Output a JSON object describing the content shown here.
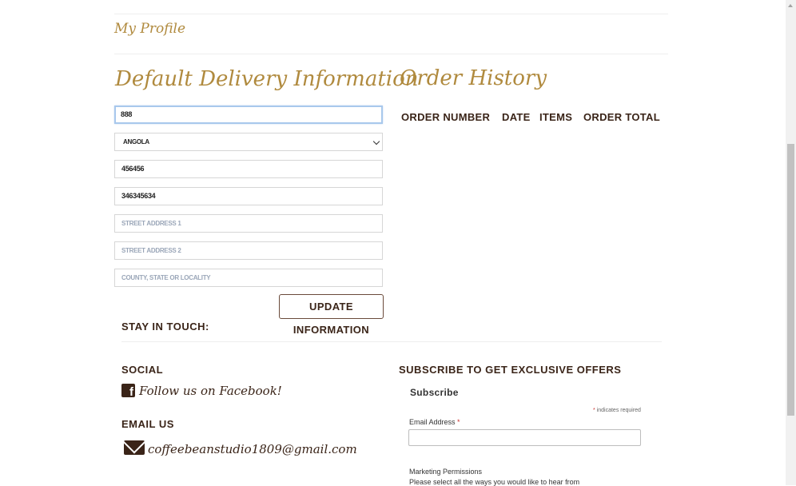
{
  "profile": {
    "title": "My Profile"
  },
  "delivery": {
    "title": "Default Delivery Information",
    "fields": [
      {
        "value": "888",
        "placeholder": ""
      },
      {
        "value": "ANGOLA",
        "placeholder": ""
      },
      {
        "value": "456456",
        "placeholder": ""
      },
      {
        "value": "346345634",
        "placeholder": ""
      },
      {
        "value": "",
        "placeholder": "STREET ADDRESS 1"
      },
      {
        "value": "",
        "placeholder": "STREET ADDRESS 2"
      },
      {
        "value": "",
        "placeholder": "COUNTY, STATE OR LOCALITY"
      }
    ],
    "update_label": "UPDATE INFORMATION"
  },
  "orders": {
    "title": "Order History",
    "columns": [
      "ORDER NUMBER",
      "DATE",
      "ITEMS",
      "ORDER TOTAL"
    ]
  },
  "footer": {
    "stay_in_touch": "STAY IN TOUCH:",
    "social_heading": "SOCIAL",
    "facebook_label": "Follow us on Facebook!",
    "email_heading": "EMAIL US",
    "email_address": "coffeebeanstudio1809@gmail.com",
    "subscribe_heading": "SUBSCRIBE TO GET EXCLUSIVE OFFERS",
    "subscribe_title": "Subscribe",
    "required_note": "indicates required",
    "email_field_label": "Email Address",
    "marketing_title": "Marketing Permissions",
    "marketing_desc": "Please select all the ways you would like to hear from"
  },
  "icons": {
    "facebook": "facebook-square-icon",
    "email": "envelope-icon",
    "select": "chevron-down-icon"
  }
}
